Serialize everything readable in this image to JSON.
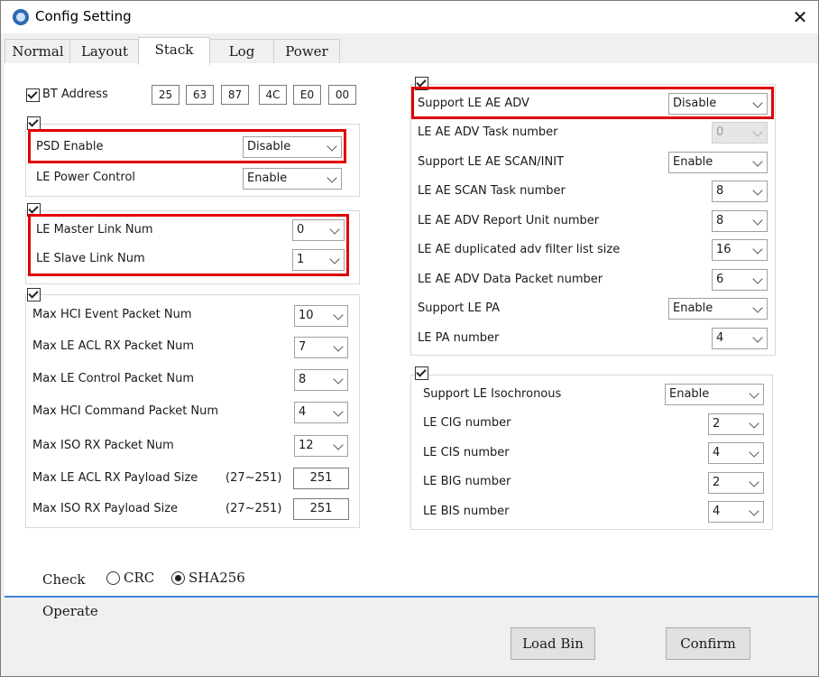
{
  "window": {
    "title": "Config Setting",
    "close": "✕"
  },
  "tabs": [
    "Normal",
    "Layout",
    "Stack",
    "Log",
    "Power"
  ],
  "bt_address": {
    "label": "BT Address",
    "bytes": [
      "25",
      "63",
      "87",
      "4C",
      "E0",
      "00"
    ]
  },
  "left": {
    "group1": [
      {
        "label": "PSD Enable",
        "value": "Disable"
      },
      {
        "label": "LE Power Control",
        "value": "Enable"
      }
    ],
    "group2": [
      {
        "label": "LE Master Link Num",
        "value": "0"
      },
      {
        "label": "LE Slave Link Num",
        "value": "1"
      }
    ],
    "group3": [
      {
        "label": "Max HCI Event Packet Num",
        "value": "10"
      },
      {
        "label": "Max LE ACL RX Packet Num",
        "value": "7"
      },
      {
        "label": "Max LE Control Packet Num",
        "value": "8"
      },
      {
        "label": "Max HCI Command Packet Num",
        "value": "4"
      },
      {
        "label": "Max ISO RX Packet Num",
        "value": "12"
      }
    ],
    "payload": [
      {
        "label": "Max LE ACL RX Payload Size",
        "range": "(27~251)",
        "value": "251"
      },
      {
        "label": "Max ISO RX Payload Size",
        "range": "(27~251)",
        "value": "251"
      }
    ]
  },
  "right": {
    "group1": [
      {
        "label": "Support LE AE ADV",
        "value": "Disable"
      },
      {
        "label": "LE AE ADV Task number",
        "value": "0"
      },
      {
        "label": "Support LE AE SCAN/INIT",
        "value": "Enable"
      },
      {
        "label": "LE AE SCAN Task number",
        "value": "8"
      },
      {
        "label": "LE AE ADV Report Unit number",
        "value": "8"
      },
      {
        "label": "LE AE duplicated adv filter list size",
        "value": "16"
      },
      {
        "label": "LE AE ADV Data Packet number",
        "value": "6"
      },
      {
        "label": "Support LE PA",
        "value": "Enable"
      },
      {
        "label": "LE PA number",
        "value": "4"
      }
    ],
    "group2": [
      {
        "label": "Support LE Isochronous",
        "value": "Enable"
      },
      {
        "label": "LE CIG number",
        "value": "2"
      },
      {
        "label": "LE CIS number",
        "value": "4"
      },
      {
        "label": "LE BIG number",
        "value": "2"
      },
      {
        "label": "LE BIS number",
        "value": "4"
      }
    ]
  },
  "check": {
    "label": "Check",
    "options": [
      "CRC",
      "SHA256"
    ],
    "selected": "SHA256"
  },
  "operate": {
    "label": "Operate",
    "load_bin": "Load Bin",
    "confirm": "Confirm"
  },
  "colors": {
    "highlight": "#e00000",
    "accent": "#3a86d6"
  }
}
